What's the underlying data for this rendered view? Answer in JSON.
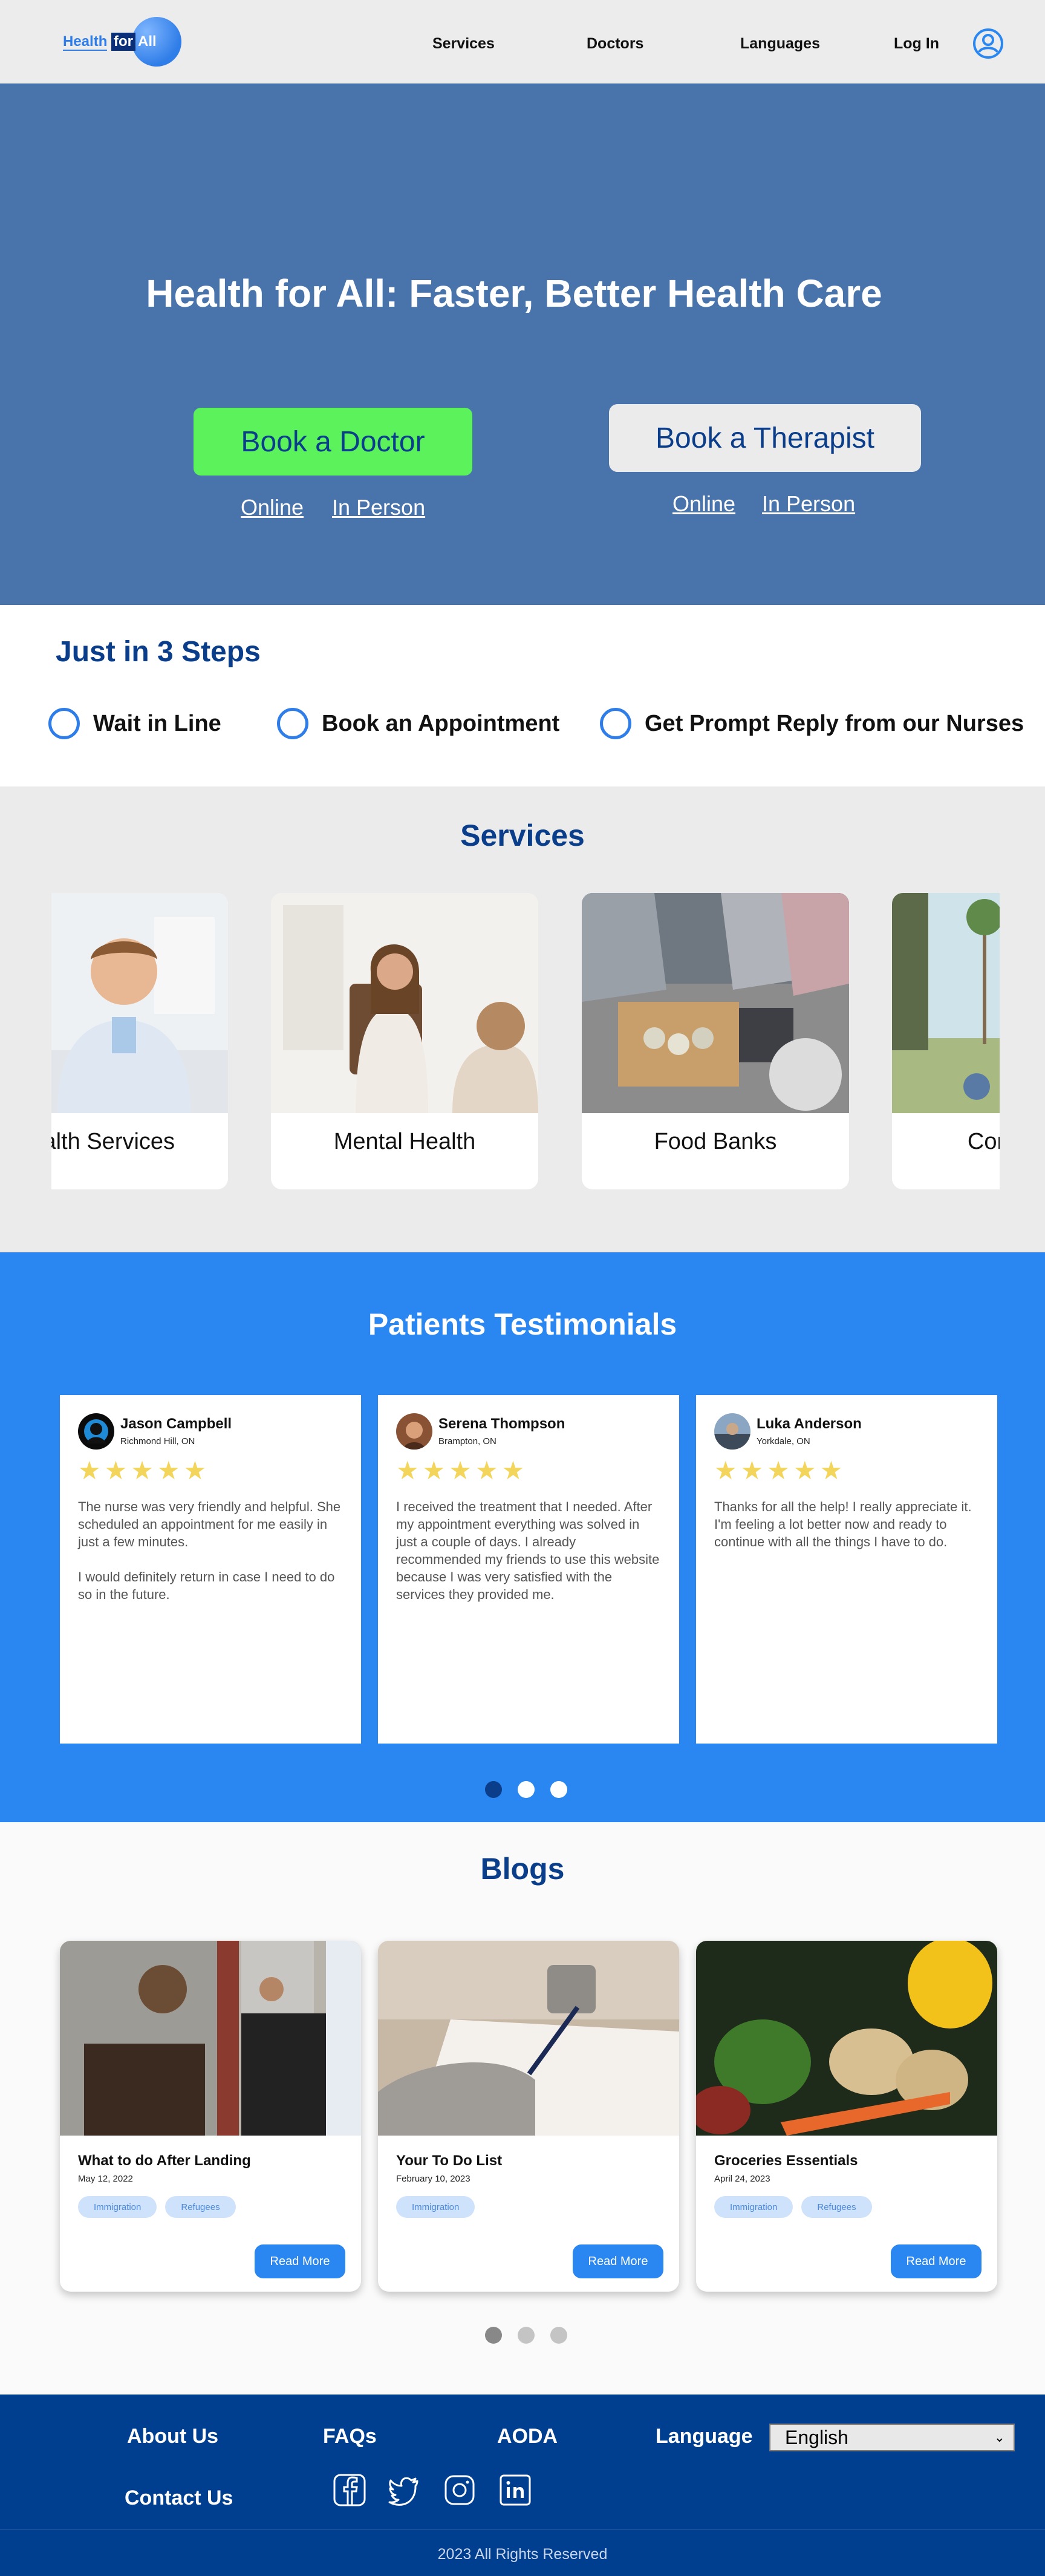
{
  "header": {
    "logo": {
      "word1": "Health",
      "word2": "for",
      "word3": "All"
    },
    "nav": {
      "services": "Services",
      "doctors": "Doctors",
      "languages": "Languages",
      "login": "Log In"
    },
    "user_icon": "user-circle-icon"
  },
  "hero": {
    "title": "Health for All: Faster, Better Health Care",
    "doctor": {
      "button": "Book a Doctor",
      "online": "Online",
      "in_person": "In Person"
    },
    "therapist": {
      "button": "Book a Therapist",
      "online": "Online",
      "in_person": "In Person"
    }
  },
  "steps": {
    "title": "Just in 3 Steps",
    "items": [
      {
        "label": "Wait in Line"
      },
      {
        "label": "Book an Appointment"
      },
      {
        "label": "Get Prompt Reply from our Nurses"
      }
    ]
  },
  "services": {
    "title": "Services",
    "items": [
      {
        "label": "Health Services"
      },
      {
        "label": "Mental Health"
      },
      {
        "label": "Food Banks"
      },
      {
        "label": "Community"
      }
    ]
  },
  "testimonials": {
    "title": "Patients Testimonials",
    "items": [
      {
        "name": "Jason Campbell",
        "location": "Richmond Hill, ON",
        "stars": "★★★★★",
        "text": "The nurse was very friendly and helpful. She scheduled an appointment for me easily in just a few minutes.\n\nI would definitely return in case I need to do so in the future."
      },
      {
        "name": "Serena Thompson",
        "location": "Brampton, ON",
        "stars": "★★★★★",
        "text": "I received the treatment that I needed. After my appointment everything was solved in just a couple of days. I already recommended my friends to use this website because I was very satisfied with the services they provided me."
      },
      {
        "name": "Luka Anderson",
        "location": "Yorkdale, ON",
        "stars": "★★★★★",
        "text": "Thanks for all the help! I really appreciate it. I'm feeling a lot better now and ready to continue with all the things I have to do."
      }
    ]
  },
  "blogs": {
    "title": "Blogs",
    "items": [
      {
        "title": "What to do After Landing",
        "date": "May 12, 2022",
        "tags": [
          "Immigration",
          "Refugees"
        ],
        "button": "Read More"
      },
      {
        "title": "Your To Do List",
        "date": "February 10, 2023",
        "tags": [
          "Immigration"
        ],
        "button": "Read More"
      },
      {
        "title": "Groceries Essentials",
        "date": "April 24, 2023",
        "tags": [
          "Immigration",
          "Refugees"
        ],
        "button": "Read More"
      }
    ]
  },
  "footer": {
    "about": "About Us",
    "faqs": "FAQs",
    "aoda": "AODA",
    "language_label": "Language",
    "language_value": "English",
    "contact": "Contact Us",
    "social": [
      "facebook-icon",
      "twitter-icon",
      "instagram-icon",
      "linkedin-icon"
    ],
    "copyright": "2023 All Rights Reserved"
  },
  "colors": {
    "hero_bg": "#4873ab",
    "brand_dark": "#0a3d8a",
    "accent_blue": "#2a86f0",
    "green_button": "#5cf25c",
    "footer_bg": "#003e8f",
    "star": "#f2d55a"
  }
}
